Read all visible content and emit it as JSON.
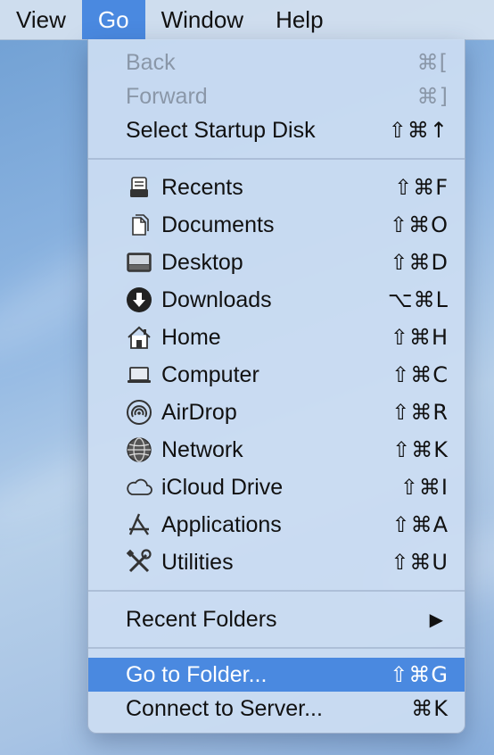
{
  "menubar": {
    "items": [
      {
        "label": "View",
        "active": false
      },
      {
        "label": "Go",
        "active": true
      },
      {
        "label": "Window",
        "active": false
      },
      {
        "label": "Help",
        "active": false
      }
    ]
  },
  "go_menu": {
    "section1": [
      {
        "label": "Back",
        "shortcut": "⌘[",
        "enabled": false
      },
      {
        "label": "Forward",
        "shortcut": "⌘]",
        "enabled": false
      },
      {
        "label": "Select Startup Disk",
        "shortcut": "⇧⌘↑",
        "enabled": true
      }
    ],
    "places": [
      {
        "label": "Recents",
        "shortcut": "⇧⌘F",
        "icon": "recents-icon"
      },
      {
        "label": "Documents",
        "shortcut": "⇧⌘O",
        "icon": "documents-icon"
      },
      {
        "label": "Desktop",
        "shortcut": "⇧⌘D",
        "icon": "desktop-icon"
      },
      {
        "label": "Downloads",
        "shortcut": "⌥⌘L",
        "icon": "downloads-icon"
      },
      {
        "label": "Home",
        "shortcut": "⇧⌘H",
        "icon": "home-icon"
      },
      {
        "label": "Computer",
        "shortcut": "⇧⌘C",
        "icon": "computer-icon"
      },
      {
        "label": "AirDrop",
        "shortcut": "⇧⌘R",
        "icon": "airdrop-icon"
      },
      {
        "label": "Network",
        "shortcut": "⇧⌘K",
        "icon": "network-icon"
      },
      {
        "label": "iCloud Drive",
        "shortcut": "⇧⌘I",
        "icon": "icloud-icon"
      },
      {
        "label": "Applications",
        "shortcut": "⇧⌘A",
        "icon": "applications-icon"
      },
      {
        "label": "Utilities",
        "shortcut": "⇧⌘U",
        "icon": "utilities-icon"
      }
    ],
    "recent_folders": {
      "label": "Recent Folders",
      "submenu_indicator": "▶"
    },
    "go_to_folder": {
      "label": "Go to Folder...",
      "shortcut": "⇧⌘G",
      "selected": true
    },
    "connect_to_server": {
      "label": "Connect to Server...",
      "shortcut": "⌘K"
    }
  },
  "colors": {
    "highlight": "#4a89e0",
    "menu_background": "#cbddf2",
    "disabled_text": "#8a97a8"
  }
}
